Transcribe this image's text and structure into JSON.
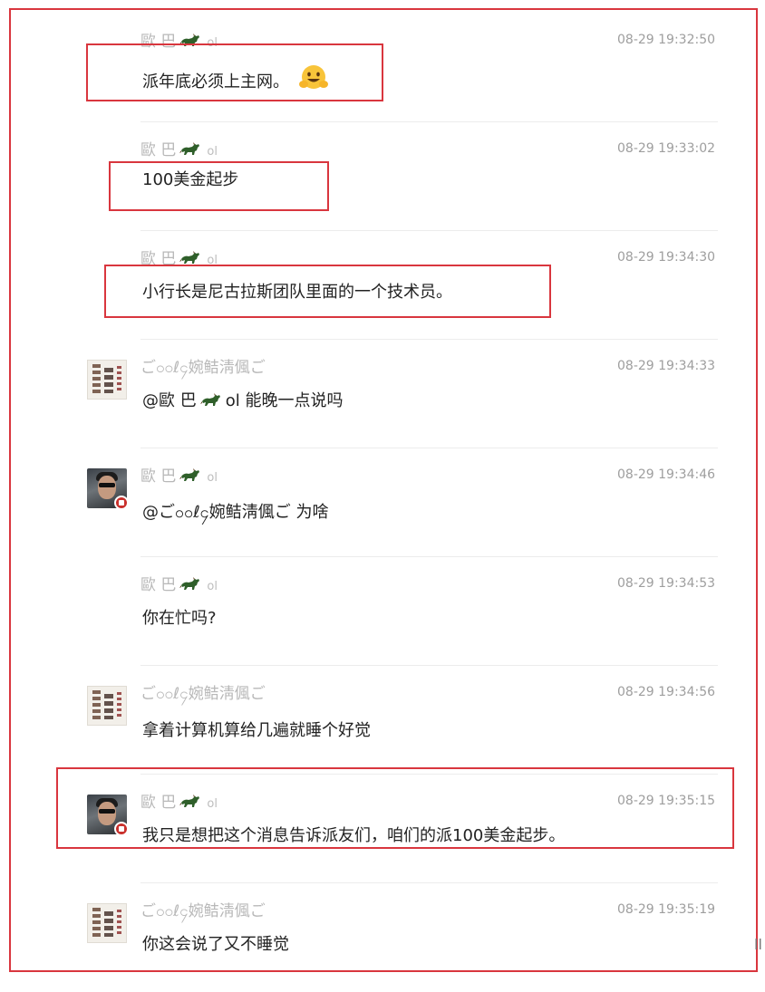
{
  "messages": [
    {
      "name": "歐 巴",
      "sig": "ol",
      "time": "08-29 19:32:50",
      "text": "派年底必须上主网。",
      "emoji": "hug-emoji",
      "avatar": "none",
      "highlighted": true
    },
    {
      "name": "歐 巴",
      "sig": "ol",
      "time": "08-29 19:33:02",
      "text": "100美金起步",
      "avatar": "none",
      "highlighted": true
    },
    {
      "name": "歐 巴",
      "sig": "ol",
      "time": "08-29 19:34:30",
      "text": "小行长是尼古拉斯团队里面的一个技术员。",
      "avatar": "none",
      "highlighted": true
    },
    {
      "name": "ご၀၀ℓ၄婉鲒淸偑ご",
      "time": "08-29 19:34:33",
      "text_pre": "@歐 巴",
      "text_post": "ol 能晚一点说吗",
      "avatar": "calligraphy",
      "highlighted": false
    },
    {
      "name": "歐 巴",
      "sig": "ol",
      "time": "08-29 19:34:46",
      "text": "@ご၀၀ℓ၄婉鲒淸偑ご 为啥",
      "avatar": "man-sunglasses",
      "highlighted": false
    },
    {
      "name": "歐 巴",
      "sig": "ol",
      "time": "08-29 19:34:53",
      "text": "你在忙吗?",
      "avatar": "none",
      "highlighted": false
    },
    {
      "name": "ご၀၀ℓ၄婉鲒淸偑ご",
      "time": "08-29 19:34:56",
      "text": "拿着计算机算给几遍就睡个好觉",
      "avatar": "calligraphy",
      "highlighted": false
    },
    {
      "name": "歐 巴",
      "sig": "ol",
      "time": "08-29 19:35:15",
      "text": "我只是想把这个消息告诉派友们，咱们的派100美金起步。",
      "avatar": "man-sunglasses",
      "highlighted": true
    },
    {
      "name": "ご၀၀ℓ၄婉鲒淸偑ご",
      "time": "08-29 19:35:19",
      "text": "你这会说了又不睡觉",
      "avatar": "calligraphy",
      "highlighted": false
    }
  ],
  "colors": {
    "highlight": "#d9363e",
    "name": "#b8b8b8",
    "time": "#9e9e9e",
    "text": "#222222"
  },
  "edge_text": "ll"
}
